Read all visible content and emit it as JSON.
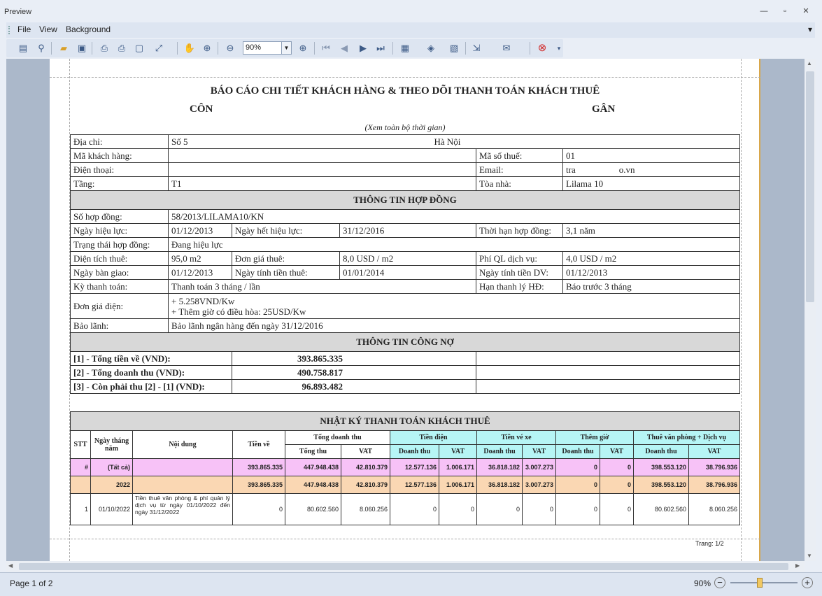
{
  "window": {
    "title": "Preview"
  },
  "menu": {
    "file": "File",
    "view": "View",
    "background": "Background"
  },
  "toolbar": {
    "zoom": "90%"
  },
  "report": {
    "title1": "BÁO CÁO CHI TIẾT KHÁCH HÀNG & THEO DÕI THANH TOÁN KHÁCH THUÊ",
    "title2_left": "CÔN",
    "title2_right": "GÂN",
    "subtitle": "(Xem toàn bộ thời gian)",
    "labels": {
      "address": "Địa chỉ:",
      "customer_code": "Mã khách hàng:",
      "tax_code": "Mã số thuế:",
      "phone": "Điện thoại:",
      "email": "Email:",
      "floor": "Tầng:",
      "building": "Tòa nhà:",
      "contract_section": "THÔNG TIN HỢP ĐỒNG",
      "contract_no": "Số hợp đồng:",
      "effective_date": "Ngày hiệu lực:",
      "expiry_date": "Ngày hết hiệu lực:",
      "term": "Thời hạn hợp đồng:",
      "status": "Trạng thái hợp đồng:",
      "area": "Diện tích thuê:",
      "unit_price": "Đơn giá thuê:",
      "service_fee": "Phí QL dịch vụ:",
      "handover": "Ngày bàn giao:",
      "rent_start": "Ngày tính tiền thuê:",
      "service_start": "Ngày tính tiền DV:",
      "payment_period": "Kỳ thanh toán:",
      "liquidation": "Hạn thanh lý HĐ:",
      "electric_price": "Đơn giá điện:",
      "guarantee": "Bảo lãnh:",
      "debt_section": "THÔNG TIN CÔNG NỢ",
      "received": "[1] - Tổng tiền về (VND):",
      "revenue": "[2] - Tổng doanh thu (VND):",
      "remaining": "[3] - Còn phải thu [2] - [1] (VND):",
      "log_section": "NHẬT KÝ THANH TOÁN KHÁCH THUÊ"
    },
    "values": {
      "address_left": "Số 5",
      "address_right": "Hà Nội",
      "tax_code": "01",
      "email_left": "tra",
      "email_right": "o.vn",
      "floor": "T1",
      "building": "Lilama 10",
      "contract_no": "58/2013/LILAMA10/KN",
      "effective_date": "01/12/2013",
      "expiry_date": "31/12/2016",
      "term": "3,1 năm",
      "status": "Đang hiệu lực",
      "area": "95,0 m2",
      "unit_price": "8,0 USD / m2",
      "service_fee": "4,0 USD / m2",
      "handover": "01/12/2013",
      "rent_start": "01/01/2014",
      "service_start": "01/12/2013",
      "payment_period": "Thanh toán 3 tháng / lần",
      "liquidation": "Báo trước 3 tháng",
      "electric_1": "+ 5.258VND/Kw",
      "electric_2": "+ Thêm giờ có điều hòa: 25USD/Kw",
      "guarantee": "Bảo lãnh ngân hàng đến ngày 31/12/2016",
      "received": "393.865.335",
      "revenue": "490.758.817",
      "remaining": "96.893.482"
    },
    "log_headers": {
      "stt": "STT",
      "date": "Ngày tháng năm",
      "content": "Nội dung",
      "received": "Tiền về",
      "total_rev": "Tổng doanh thu",
      "electric": "Tiền điện",
      "parking": "Tiền vé xe",
      "overtime": "Thêm giờ",
      "office": "Thuê văn phòng + Dịch vụ",
      "total_collected": "Tổng thu",
      "vat": "VAT",
      "revenue": "Doanh thu"
    },
    "rows": [
      {
        "stt": "#",
        "date": "(Tất cả)",
        "content": "",
        "received": "393.865.335",
        "total": "447.948.438",
        "total_vat": "42.810.379",
        "elec": "12.577.136",
        "elec_vat": "1.006.171",
        "park": "36.818.182",
        "park_vat": "3.007.273",
        "ot": "0",
        "ot_vat": "0",
        "office": "398.553.120",
        "office_vat": "38.796.936"
      },
      {
        "stt": "",
        "date": "2022",
        "content": "",
        "received": "393.865.335",
        "total": "447.948.438",
        "total_vat": "42.810.379",
        "elec": "12.577.136",
        "elec_vat": "1.006.171",
        "park": "36.818.182",
        "park_vat": "3.007.273",
        "ot": "0",
        "ot_vat": "0",
        "office": "398.553.120",
        "office_vat": "38.796.936"
      },
      {
        "stt": "1",
        "date": "01/10/2022",
        "content": "Tiền thuê văn phòng & phí quản lý dịch vụ từ ngày 01/10/2022 đến ngày 31/12/2022",
        "received": "0",
        "total": "80.602.560",
        "total_vat": "8.060.256",
        "elec": "0",
        "elec_vat": "0",
        "park": "0",
        "park_vat": "0",
        "ot": "0",
        "ot_vat": "0",
        "office": "80.602.560",
        "office_vat": "8.060.256"
      }
    ],
    "footer": "Trang: 1/2"
  },
  "status": {
    "page": "Page 1 of 2",
    "zoom": "90%"
  }
}
